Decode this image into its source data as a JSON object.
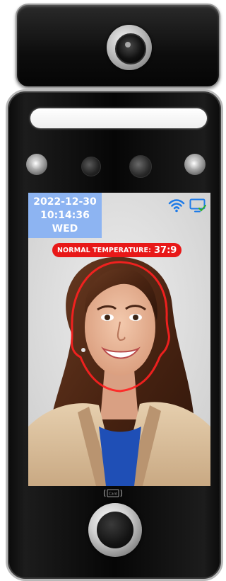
{
  "device": {
    "screen": {
      "date": "2022-12-30",
      "time": "10:14:36",
      "weekday": "WED",
      "temperature_label": "NORMAL TEMPERATURE:",
      "temperature_value": "37:9",
      "status_icons": [
        "wifi-icon",
        "monitor-check-icon"
      ]
    },
    "card_reader_label": "Card"
  },
  "colors": {
    "datetime_panel": "#8db4f2",
    "temperature_badge": "#e81818",
    "face_frame": "#ff2020",
    "status_icon": "#1e7be8"
  }
}
